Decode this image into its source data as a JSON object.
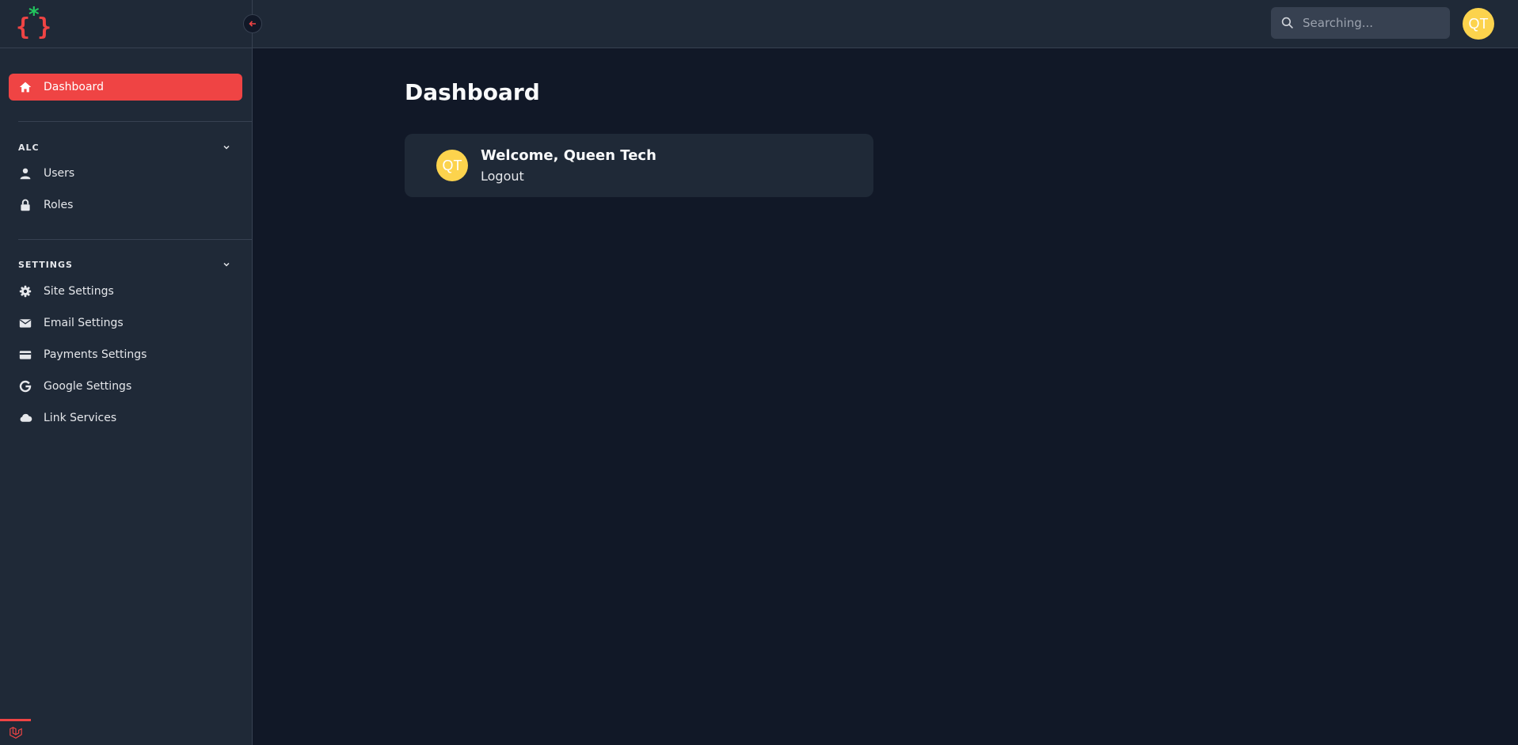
{
  "brand": {
    "logo_left": "{",
    "logo_right": "}",
    "logo_star": "*"
  },
  "colors": {
    "accent": "#ef4444",
    "logo_star": "#22c55e",
    "avatar": "#fcd34d",
    "bg": "#111827",
    "panel": "#1f2937"
  },
  "sidebar": {
    "active_item": {
      "label": "Dashboard",
      "icon": "home-icon"
    },
    "groups": [
      {
        "title": "ALC",
        "items": [
          {
            "label": "Users",
            "icon": "user-icon"
          },
          {
            "label": "Roles",
            "icon": "lock-icon"
          }
        ]
      },
      {
        "title": "SETTINGS",
        "items": [
          {
            "label": "Site Settings",
            "icon": "gear-icon"
          },
          {
            "label": "Email Settings",
            "icon": "mail-icon"
          },
          {
            "label": "Payments Settings",
            "icon": "credit-card-icon"
          },
          {
            "label": "Google Settings",
            "icon": "google-icon"
          },
          {
            "label": "Link Services",
            "icon": "cloud-icon"
          }
        ]
      }
    ]
  },
  "topbar": {
    "search": {
      "placeholder": "Searching..."
    },
    "avatar_initials": "QT"
  },
  "main": {
    "title": "Dashboard",
    "welcome_card": {
      "avatar_initials": "QT",
      "greeting": "Welcome, Queen Tech",
      "logout_label": "Logout"
    }
  }
}
